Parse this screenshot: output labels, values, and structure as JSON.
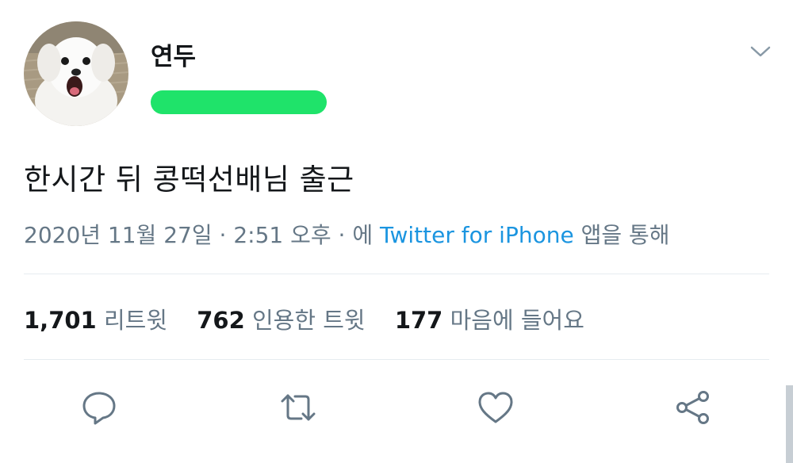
{
  "user": {
    "display_name": "연두",
    "handle_redacted": true
  },
  "tweet": {
    "text": "한시간 뒤 콩떡선배님 출근",
    "date": "2020년 11월 27일",
    "separator": "·",
    "time": "2:51 오후",
    "via_prefix": "에",
    "source": "Twitter for iPhone",
    "via_suffix": "앱을 통해"
  },
  "stats": {
    "retweets": {
      "count": "1,701",
      "label": "리트윗"
    },
    "quotes": {
      "count": "762",
      "label": "인용한 트윗"
    },
    "likes": {
      "count": "177",
      "label": "마음에 들어요"
    }
  },
  "actions": [
    {
      "name": "reply",
      "icon": "reply-icon"
    },
    {
      "name": "retweet",
      "icon": "retweet-icon"
    },
    {
      "name": "like",
      "icon": "heart-icon"
    },
    {
      "name": "share",
      "icon": "share-icon"
    }
  ],
  "colors": {
    "text": "#14171a",
    "secondary": "#657786",
    "link": "#1b95e0",
    "divider": "#e6ecf0",
    "redaction": "#1fe36a"
  }
}
